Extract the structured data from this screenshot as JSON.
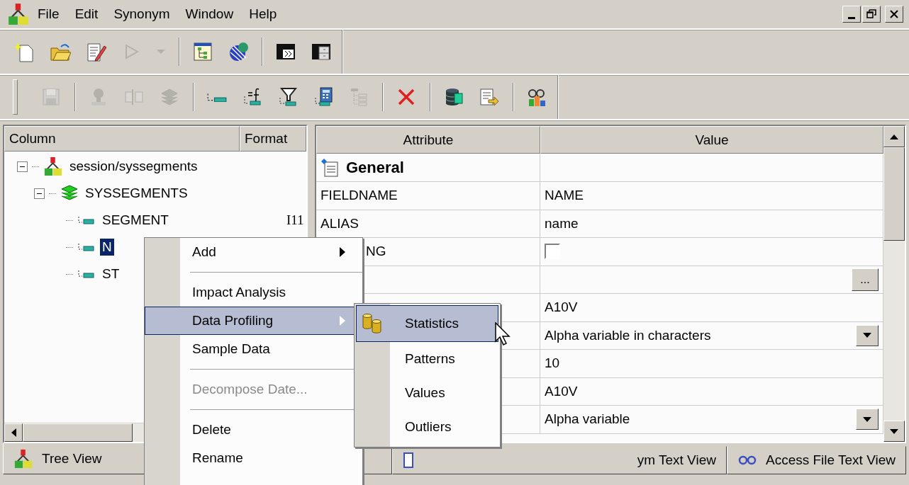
{
  "menubar": {
    "items": [
      "File",
      "Edit",
      "Synonym",
      "Window",
      "Help"
    ]
  },
  "toolbars": [
    [
      {
        "kind": "new-file",
        "disabled": false
      },
      {
        "kind": "open-folder",
        "disabled": false
      },
      {
        "kind": "edit-document",
        "disabled": false
      },
      {
        "kind": "play",
        "disabled": true
      },
      {
        "kind": "caret",
        "disabled": true
      },
      {
        "kind": "separator"
      },
      {
        "kind": "tree-window",
        "disabled": false
      },
      {
        "kind": "globe",
        "disabled": false
      },
      {
        "kind": "separator"
      },
      {
        "kind": "run-window",
        "disabled": false
      },
      {
        "kind": "cabinet-window",
        "disabled": false
      }
    ],
    [
      {
        "kind": "save",
        "disabled": true
      },
      {
        "kind": "separator"
      },
      {
        "kind": "tree-node",
        "disabled": true
      },
      {
        "kind": "join",
        "disabled": true
      },
      {
        "kind": "stack",
        "disabled": true
      },
      {
        "kind": "separator"
      },
      {
        "kind": "field",
        "disabled": false
      },
      {
        "kind": "formula",
        "disabled": false
      },
      {
        "kind": "filter",
        "disabled": false
      },
      {
        "kind": "calculator",
        "disabled": false
      },
      {
        "kind": "tree-list",
        "disabled": true
      },
      {
        "kind": "separator"
      },
      {
        "kind": "delete",
        "disabled": false
      },
      {
        "kind": "separator"
      },
      {
        "kind": "database",
        "disabled": false
      },
      {
        "kind": "export",
        "disabled": false
      },
      {
        "kind": "separator"
      },
      {
        "kind": "chart",
        "disabled": false
      }
    ]
  ],
  "tree": {
    "columns": [
      "Column",
      "Format"
    ],
    "nodes": [
      {
        "label": "session/syssegments",
        "kind": "root",
        "expanded": true,
        "selected": false,
        "children": [
          {
            "label": "SYSSEGMENTS",
            "kind": "segment",
            "expanded": true,
            "selected": false,
            "children": [
              {
                "label": "SEGMENT",
                "format": "I11",
                "kind": "field",
                "selected": false
              },
              {
                "label": "N",
                "kind": "field",
                "selected": true
              },
              {
                "label": "ST",
                "kind": "field",
                "selected": false
              }
            ]
          }
        ]
      }
    ]
  },
  "grid": {
    "columns": [
      "Attribute",
      "Value"
    ],
    "rows": [
      {
        "kind": "group",
        "attribute": "General"
      },
      {
        "kind": "text",
        "attribute": "FIELDNAME",
        "value": "NAME"
      },
      {
        "kind": "text",
        "attribute": "ALIAS",
        "value": "name"
      },
      {
        "kind": "checkbox",
        "attribute": "NG",
        "covered": true,
        "checked": false
      },
      {
        "kind": "ellipsis",
        "button": "..."
      },
      {
        "kind": "text",
        "value": "A10V"
      },
      {
        "kind": "dropdown",
        "value": "Alpha variable in characters"
      },
      {
        "kind": "text",
        "value": "10"
      },
      {
        "kind": "text",
        "value": "A10V"
      },
      {
        "kind": "dropdown",
        "value": "Alpha variable"
      }
    ]
  },
  "tabs": [
    {
      "label": "Tree View",
      "kind": "tree",
      "selected": true
    },
    {
      "label": "ym Text View",
      "kind": "synonym",
      "selected": false
    },
    {
      "label": "Access File Text View",
      "kind": "access",
      "selected": false
    }
  ],
  "context_menu": {
    "items": [
      {
        "kind": "item",
        "label": "Add",
        "submenu": true,
        "disabled": false,
        "selected": false
      },
      {
        "kind": "separator"
      },
      {
        "kind": "item",
        "label": "Impact Analysis",
        "submenu": false,
        "disabled": false,
        "selected": false
      },
      {
        "kind": "item",
        "label": "Data Profiling",
        "submenu": true,
        "disabled": false,
        "selected": true
      },
      {
        "kind": "item",
        "label": "Sample Data",
        "submenu": false,
        "disabled": false,
        "selected": false
      },
      {
        "kind": "separator"
      },
      {
        "kind": "item",
        "label": "Decompose Date...",
        "submenu": false,
        "disabled": true,
        "selected": false
      },
      {
        "kind": "separator"
      },
      {
        "kind": "item",
        "label": "Delete",
        "submenu": false,
        "disabled": false,
        "selected": false
      },
      {
        "kind": "item",
        "label": "Rename",
        "submenu": false,
        "disabled": false,
        "selected": false
      }
    ]
  },
  "submenu": {
    "items": [
      {
        "kind": "icon-item",
        "label": "Statistics",
        "selected": true
      },
      {
        "kind": "item",
        "label": "Patterns",
        "selected": false
      },
      {
        "kind": "item",
        "label": "Values",
        "selected": false
      },
      {
        "kind": "item",
        "label": "Outliers",
        "selected": false
      }
    ]
  }
}
